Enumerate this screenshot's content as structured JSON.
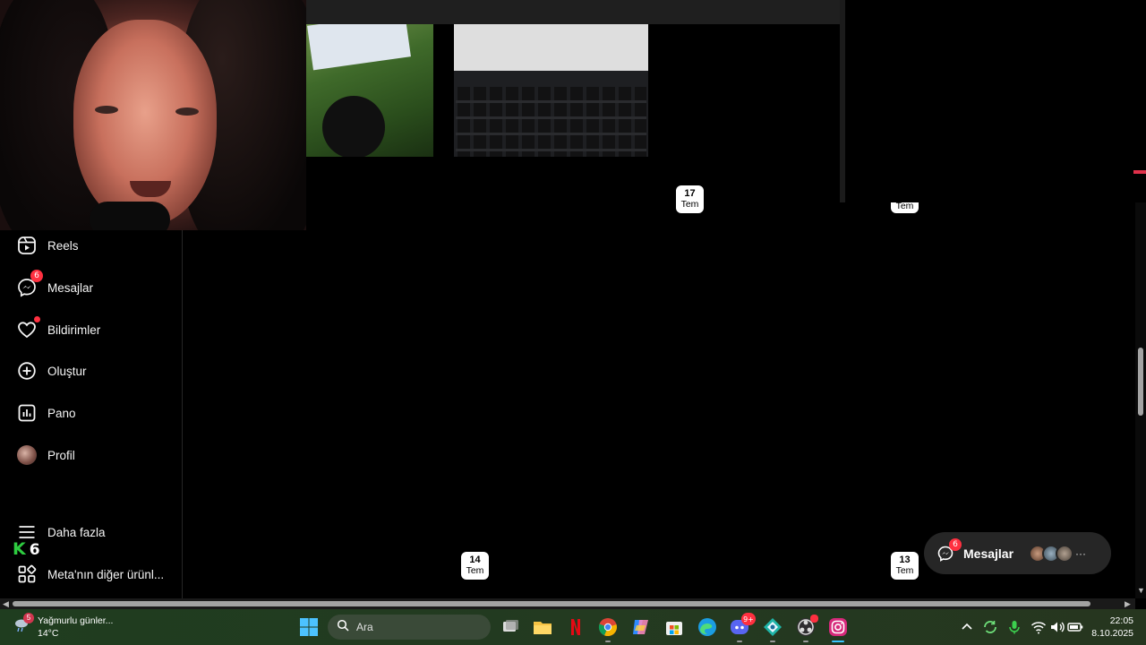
{
  "sidebar": {
    "items": [
      {
        "label": "Reels",
        "icon": "reels-icon"
      },
      {
        "label": "Mesajlar",
        "icon": "messenger-icon",
        "badge": "6"
      },
      {
        "label": "Bildirimler",
        "icon": "heart-icon"
      },
      {
        "label": "Oluştur",
        "icon": "plus-square-icon"
      },
      {
        "label": "Pano",
        "icon": "dashboard-icon"
      },
      {
        "label": "Profil",
        "icon": "avatar"
      },
      {
        "label": "Daha fazla",
        "icon": "menu-icon"
      },
      {
        "label": "Meta'nın diğer ürünl...",
        "icon": "apps-grid-icon"
      }
    ]
  },
  "overlay_logo": {
    "k": "K",
    "six": "6"
  },
  "date_chips": [
    {
      "day": "17",
      "month": "Tem"
    },
    {
      "day": "",
      "month": "Tem"
    },
    {
      "day": "14",
      "month": "Tem"
    },
    {
      "day": "13",
      "month": "Tem"
    }
  ],
  "messages_float": {
    "label": "Mesajlar",
    "badge": "6"
  },
  "taskbar": {
    "weather": {
      "title": "Yağmurlu günler...",
      "temp": "14°C",
      "badge": "5"
    },
    "search_label": "Ara",
    "apps": [
      "windows-start-icon",
      "task-view-icon",
      "file-explorer-icon",
      "netflix-icon",
      "chrome-icon",
      "copilot-icon",
      "store-icon",
      "edge-icon",
      "discord-icon",
      "gamebar-icon",
      "obs-icon",
      "instagram-icon"
    ],
    "discord_badge": "9+",
    "clock": {
      "time": "22:05",
      "date": "8.10.2025"
    }
  },
  "colors": {
    "accent_red": "#ff3040",
    "k6_green": "#2ecc40",
    "taskbar_green": "#233a20"
  }
}
